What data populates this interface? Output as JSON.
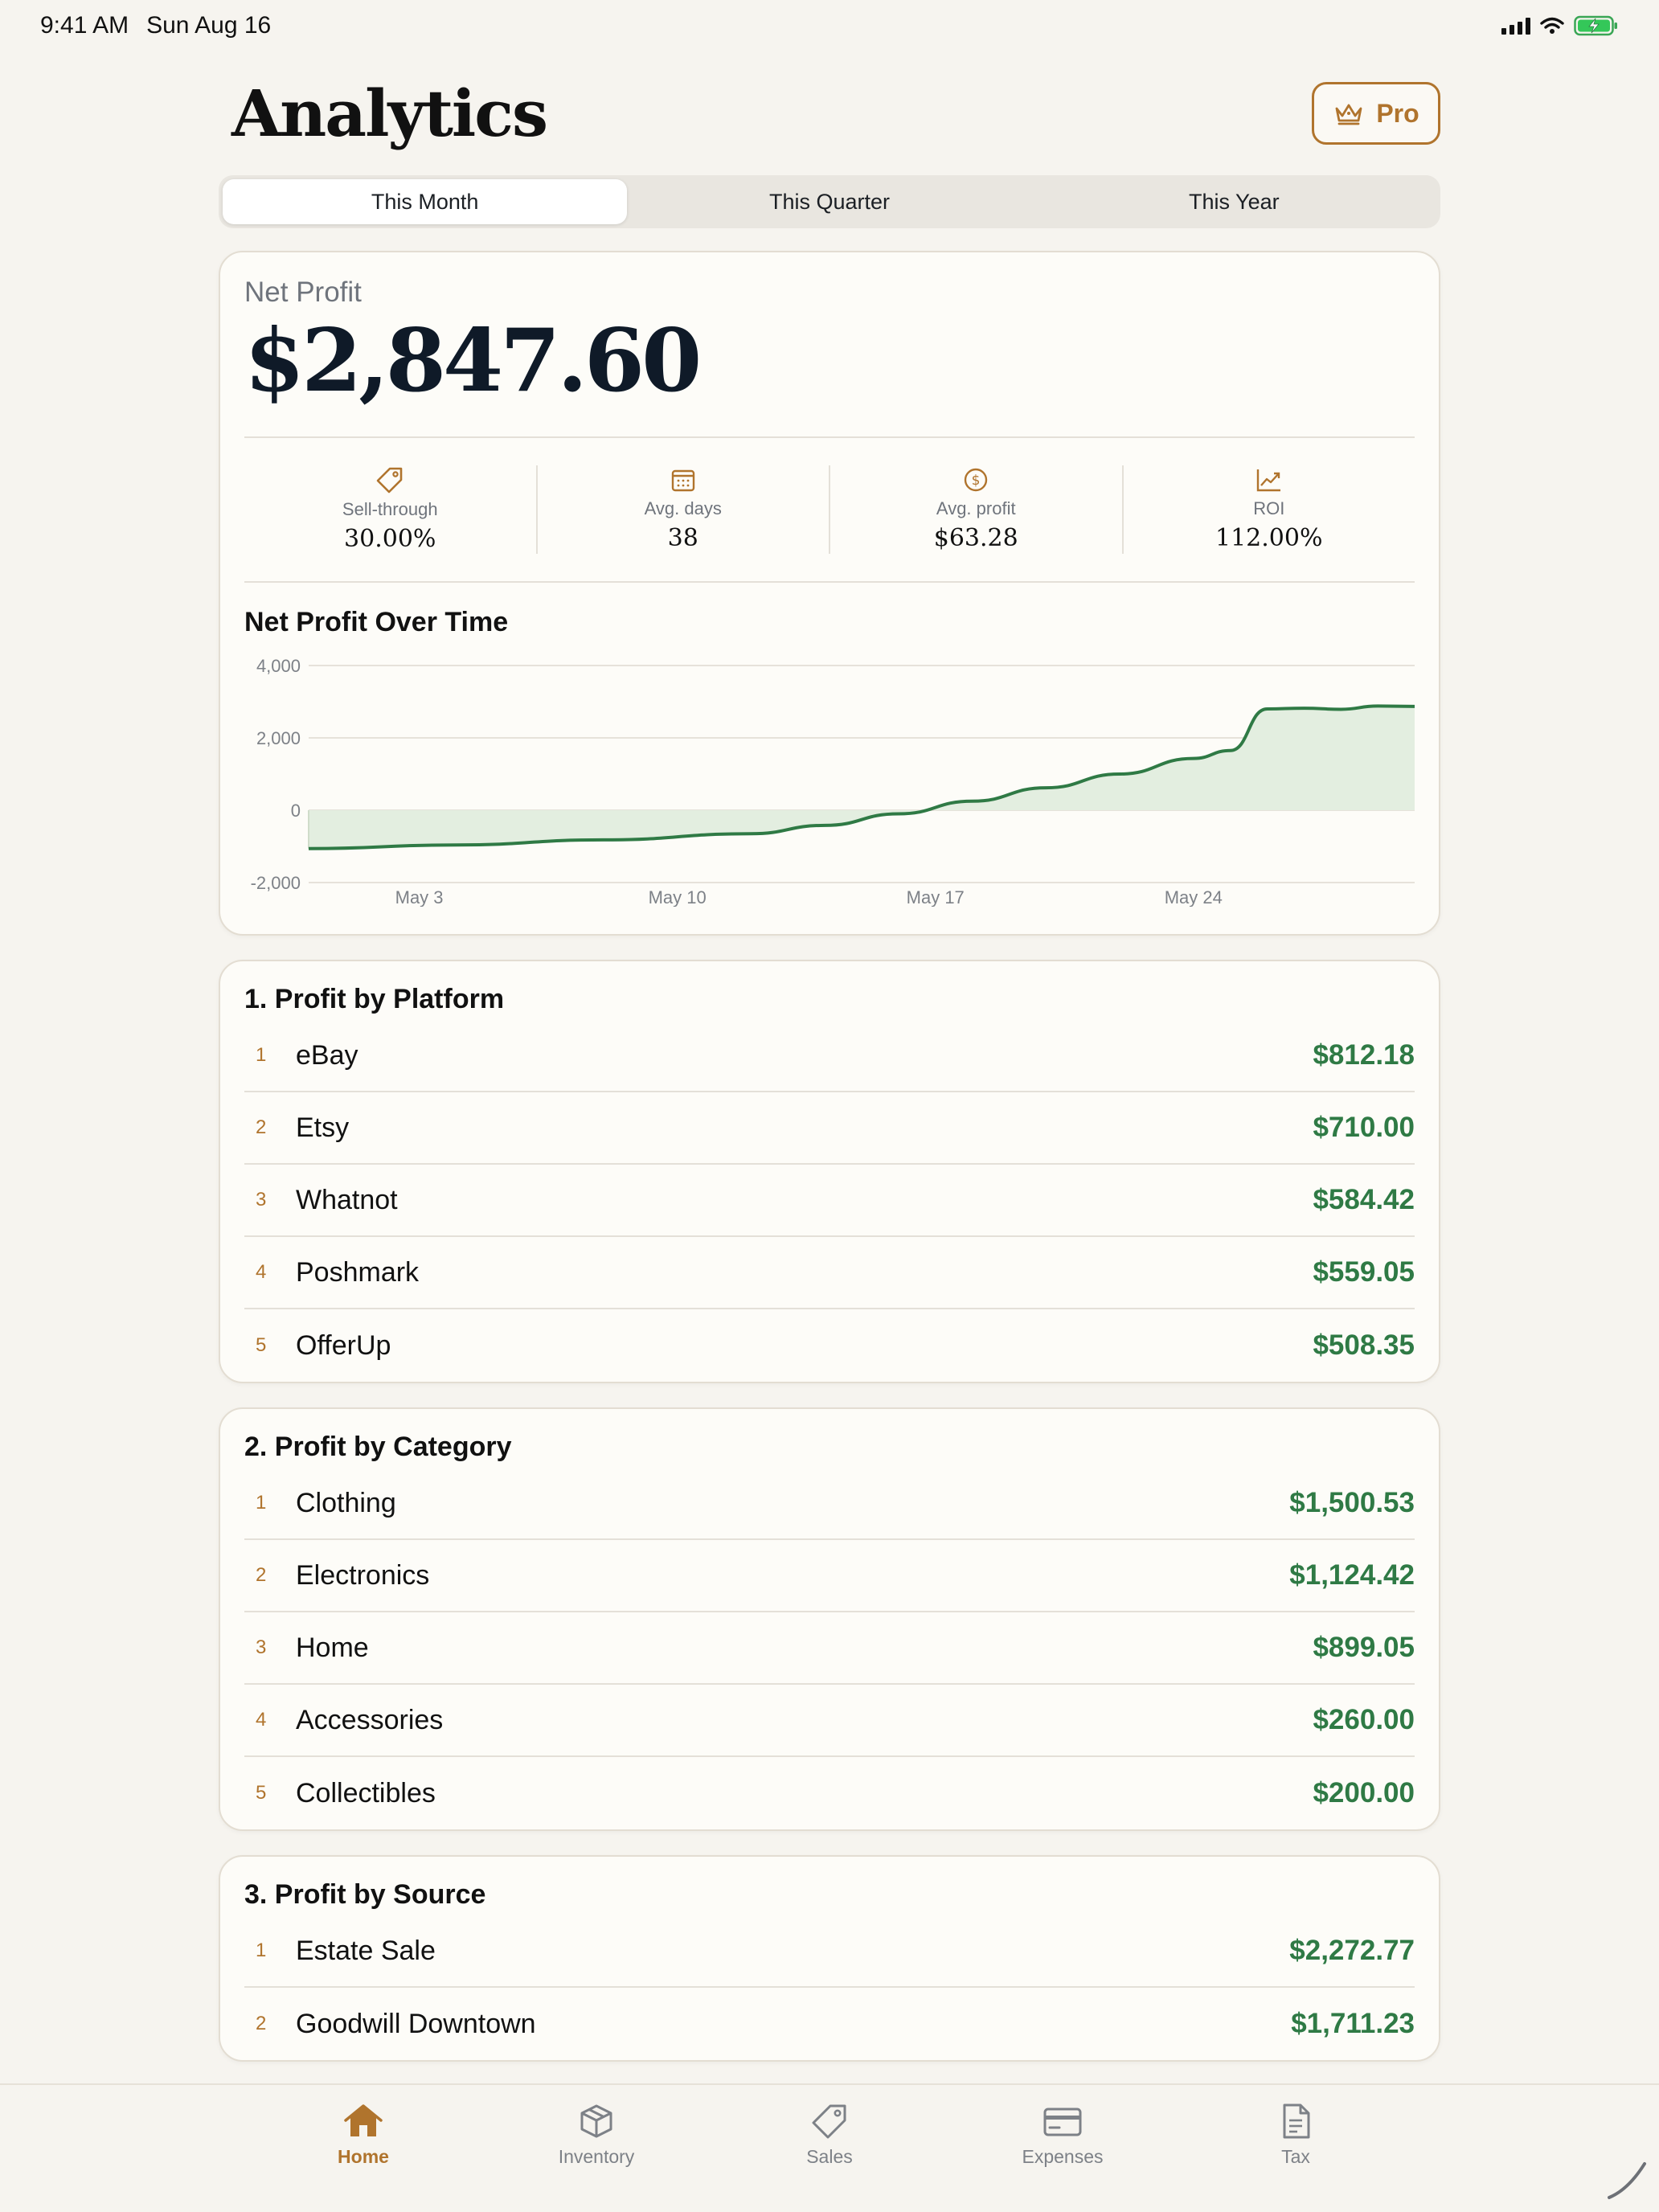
{
  "status_bar": {
    "time": "9:41 AM",
    "date": "Sun Aug 16"
  },
  "header": {
    "title": "Analytics",
    "pro_label": "Pro"
  },
  "segments": [
    {
      "label": "This Month",
      "active": true
    },
    {
      "label": "This Quarter",
      "active": false
    },
    {
      "label": "This Year",
      "active": false
    }
  ],
  "summary": {
    "net_profit_label": "Net Profit",
    "net_profit_value": "$2,847.60",
    "metrics": [
      {
        "icon": "tag-icon",
        "label": "Sell-through",
        "value": "30.00%"
      },
      {
        "icon": "calendar-icon",
        "label": "Avg. days",
        "value": "38"
      },
      {
        "icon": "dollar-circle-icon",
        "label": "Avg. profit",
        "value": "$63.28"
      },
      {
        "icon": "trend-up-icon",
        "label": "ROI",
        "value": "112.00%"
      }
    ]
  },
  "chart_data": {
    "type": "area",
    "title": "Net Profit Over Time",
    "x_tick_labels": [
      "May 3",
      "May 10",
      "May 17",
      "May 24"
    ],
    "y_tick_labels": [
      "4,000",
      "2,000",
      "0",
      "-2,000"
    ],
    "ylim": [
      -2000,
      4000
    ],
    "x_range": [
      0,
      30
    ],
    "grid": true,
    "line_color": "#2f7a45",
    "fill_color": "#e3eee0",
    "series": [
      {
        "x": [
          0,
          4,
          8,
          12,
          14,
          16,
          18,
          20,
          22,
          24,
          25,
          26,
          27,
          28,
          29,
          30
        ],
        "values": [
          -1060,
          -960,
          -820,
          -650,
          -420,
          -100,
          250,
          620,
          1000,
          1430,
          1650,
          2800,
          2820,
          2790,
          2880,
          2870
        ]
      }
    ],
    "x_tick_positions": [
      3,
      10,
      17,
      24
    ]
  },
  "platform": {
    "title": "1. Profit by Platform",
    "rows": [
      {
        "rank": "1",
        "name": "eBay",
        "value": "$812.18"
      },
      {
        "rank": "2",
        "name": "Etsy",
        "value": "$710.00"
      },
      {
        "rank": "3",
        "name": "Whatnot",
        "value": "$584.42"
      },
      {
        "rank": "4",
        "name": "Poshmark",
        "value": "$559.05"
      },
      {
        "rank": "5",
        "name": "OfferUp",
        "value": "$508.35"
      }
    ]
  },
  "category": {
    "title": "2. Profit by Category",
    "rows": [
      {
        "rank": "1",
        "name": "Clothing",
        "value": "$1,500.53"
      },
      {
        "rank": "2",
        "name": "Electronics",
        "value": "$1,124.42"
      },
      {
        "rank": "3",
        "name": "Home",
        "value": "$899.05"
      },
      {
        "rank": "4",
        "name": "Accessories",
        "value": "$260.00"
      },
      {
        "rank": "5",
        "name": "Collectibles",
        "value": "$200.00"
      }
    ]
  },
  "source": {
    "title": "3. Profit by Source",
    "rows": [
      {
        "rank": "1",
        "name": "Estate Sale",
        "value": "$2,272.77"
      },
      {
        "rank": "2",
        "name": "Goodwill Downtown",
        "value": "$1,711.23"
      }
    ]
  },
  "tabs": [
    {
      "icon": "home-icon",
      "label": "Home",
      "active": true
    },
    {
      "icon": "box-icon",
      "label": "Inventory",
      "active": false
    },
    {
      "icon": "tag-icon",
      "label": "Sales",
      "active": false
    },
    {
      "icon": "credit-card-icon",
      "label": "Expenses",
      "active": false
    },
    {
      "icon": "document-icon",
      "label": "Tax",
      "active": false
    }
  ],
  "colors": {
    "accent": "#b0742d",
    "profit_green": "#2f7a45",
    "background": "#f6f4ef"
  }
}
